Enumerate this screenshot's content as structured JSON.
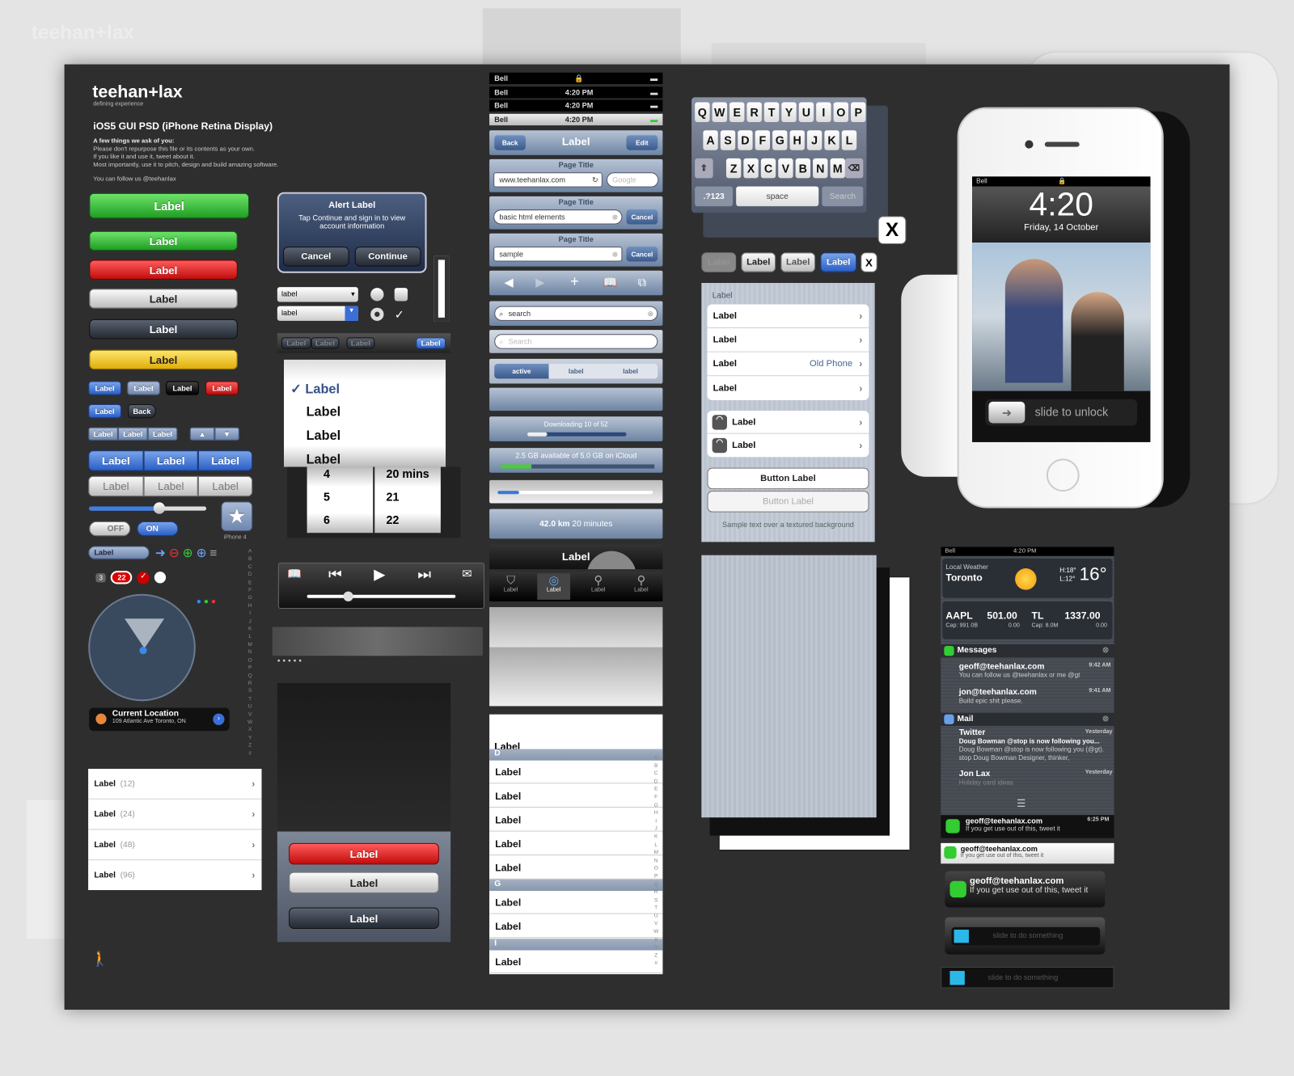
{
  "brand": {
    "logo": "teehan+lax",
    "tagline": "defining experience"
  },
  "intro": {
    "title": "iOS5 GUI PSD (iPhone Retina Display)",
    "heading": "A few things we ask of you:",
    "lines": [
      "Please don't repurpose this file or its contents as your own.",
      "If you like it and use it, tweet about it.",
      "Most importantly, use it to pitch, design and build amazing software."
    ],
    "follow": "You can follow us @teehanlax"
  },
  "buttons": {
    "label": "Label",
    "back": "Back",
    "off": "OFF",
    "on": "ON",
    "iphone4": "iPhone 4",
    "badge_small": "3",
    "badge_count": "22"
  },
  "colors": {
    "green": "#1f9d22",
    "red": "#c10d0d",
    "blue": "#2a5fc7",
    "yellow": "#e0ad0b",
    "panel": "#2e2e2f"
  },
  "slider": {
    "value": 0.6
  },
  "location": {
    "title": "Current Location",
    "address": "109 Atlantic Ave Toronto, ON"
  },
  "alphabet": [
    "A",
    "B",
    "C",
    "D",
    "E",
    "F",
    "G",
    "H",
    "I",
    "J",
    "K",
    "L",
    "M",
    "N",
    "O",
    "P",
    "Q",
    "R",
    "S",
    "T",
    "U",
    "V",
    "W",
    "X",
    "Y",
    "Z",
    "#"
  ],
  "count_list": [
    {
      "label": "Label",
      "count": "(12)"
    },
    {
      "label": "Label",
      "count": "(24)"
    },
    {
      "label": "Label",
      "count": "(48)"
    },
    {
      "label": "Label",
      "count": "(96)"
    }
  ],
  "alert": {
    "title": "Alert Label",
    "message": "Tap Continue and sign in to view account information",
    "cancel": "Cancel",
    "continue": "Continue"
  },
  "dropdowns": [
    "label",
    "label"
  ],
  "picker": {
    "items": [
      "Label",
      "Label",
      "Label",
      "Label"
    ],
    "checked_index": 0
  },
  "date_picker": {
    "rows": [
      [
        "4",
        "20 mins"
      ],
      [
        "5",
        "21"
      ],
      [
        "6",
        "22"
      ]
    ]
  },
  "action_sheet": [
    "Label",
    "Label",
    "Label"
  ],
  "status_bars": [
    {
      "carrier": "Bell",
      "time": ""
    },
    {
      "carrier": "Bell",
      "time": "4:20 PM"
    },
    {
      "carrier": "Bell",
      "time": "4:20 PM"
    },
    {
      "carrier": "Bell",
      "time": "4:20 PM"
    }
  ],
  "navbar": {
    "back": "Back",
    "title": "Label",
    "edit": "Edit"
  },
  "url_bars": [
    {
      "title": "Page Title",
      "value": "www.teehanlax.com",
      "search_placeholder": "Google"
    },
    {
      "title": "Page Title",
      "value": "basic html elements",
      "cancel": "Cancel"
    },
    {
      "title": "Page Title",
      "value": "sample",
      "cancel": "Cancel"
    }
  ],
  "search": {
    "value": "search",
    "placeholder": "Search"
  },
  "segments": [
    "active",
    "label",
    "label"
  ],
  "download": {
    "text": "Downloading 10 of 52",
    "progress": 0.2
  },
  "icloud": {
    "text": "2.5 GB available of 5.0 GB on iCloud",
    "progress": 0.2
  },
  "progress_bar": {
    "progress": 0.14
  },
  "map": {
    "distance": "42.0 km",
    "time": "20 minutes"
  },
  "tabbar": {
    "title": "Label",
    "tabs": [
      "Label",
      "Label",
      "Label",
      "Label"
    ],
    "active": 1
  },
  "index_table": {
    "header": "Label",
    "sections": [
      {
        "letter": "D",
        "rows": [
          "Label",
          "Label",
          "Label",
          "Label",
          "Label"
        ]
      },
      {
        "letter": "G",
        "rows": [
          "Label",
          "Label"
        ]
      },
      {
        "letter": "I",
        "rows": [
          "Label"
        ]
      }
    ]
  },
  "keyboard": {
    "rows": [
      [
        "Q",
        "W",
        "E",
        "R",
        "T",
        "Y",
        "U",
        "I",
        "O",
        "P"
      ],
      [
        "A",
        "S",
        "D",
        "F",
        "G",
        "H",
        "J",
        "K",
        "L"
      ],
      [
        "Z",
        "X",
        "C",
        "V",
        "B",
        "N",
        "M"
      ]
    ],
    "numbers": ".?123",
    "space": "space",
    "search": "Search",
    "close": "X"
  },
  "button_row": [
    "Label",
    "Label",
    "Label",
    "Label",
    "X"
  ],
  "grouped": {
    "header": "Label",
    "rows": [
      {
        "label": "Label",
        "detail": ""
      },
      {
        "label": "Label",
        "detail": ""
      },
      {
        "label": "Label",
        "detail": "Old Phone"
      },
      {
        "label": "Label",
        "detail": ""
      }
    ],
    "wifi_rows": [
      "Label",
      "Label"
    ],
    "button": "Button Label",
    "button_disabled": "Button Label",
    "footer": "Sample text over a textured background"
  },
  "lockscreen": {
    "carrier": "Bell",
    "time": "4:20",
    "date": "Friday, 14 October",
    "slider": "slide to unlock"
  },
  "notification_center": {
    "status": {
      "carrier": "Bell",
      "time": "4:20 PM"
    },
    "weather": {
      "label": "Local Weather",
      "city": "Toronto",
      "high": "H:18°",
      "low": "L:12°",
      "temp": "16°"
    },
    "stocks": [
      {
        "symbol": "AAPL",
        "price": "501.00",
        "cap": "Cap: 991.0B",
        "change": "0.00"
      },
      {
        "symbol": "TL",
        "price": "1337.00",
        "cap": "Cap: 8.0M",
        "change": "0.00"
      }
    ],
    "messages": {
      "title": "Messages",
      "items": [
        {
          "from": "geoff@teehanlax.com",
          "time": "9:42 AM",
          "text": "You can follow us @teehanlax or me @gt"
        },
        {
          "from": "jon@teehanlax.com",
          "time": "9:41 AM",
          "text": "Build epic shit please."
        }
      ]
    },
    "mail": {
      "title": "Mail",
      "items": [
        {
          "from": "Twitter",
          "time": "Yesterday",
          "subject": "Doug Bowman @stop is now following you...",
          "text": "Doug Bowman @stop is now following you (@gt). stop Doug Bowman Designer, thinker,"
        },
        {
          "from": "Jon Lax",
          "time": "Yesterday",
          "text": "Holiday card ideas"
        }
      ]
    }
  },
  "banners": [
    {
      "from": "geoff@teehanlax.com",
      "time": "6:25 PM",
      "text": "If you get use out of this, tweet it"
    },
    {
      "from": "geoff@teehanlax.com",
      "text": "If you get use out of this, tweet it"
    },
    {
      "from": "geoff@teehanlax.com",
      "text": "If you get use out of this, tweet it"
    }
  ],
  "slide_action": [
    "slide to do something",
    "slide to do something"
  ]
}
